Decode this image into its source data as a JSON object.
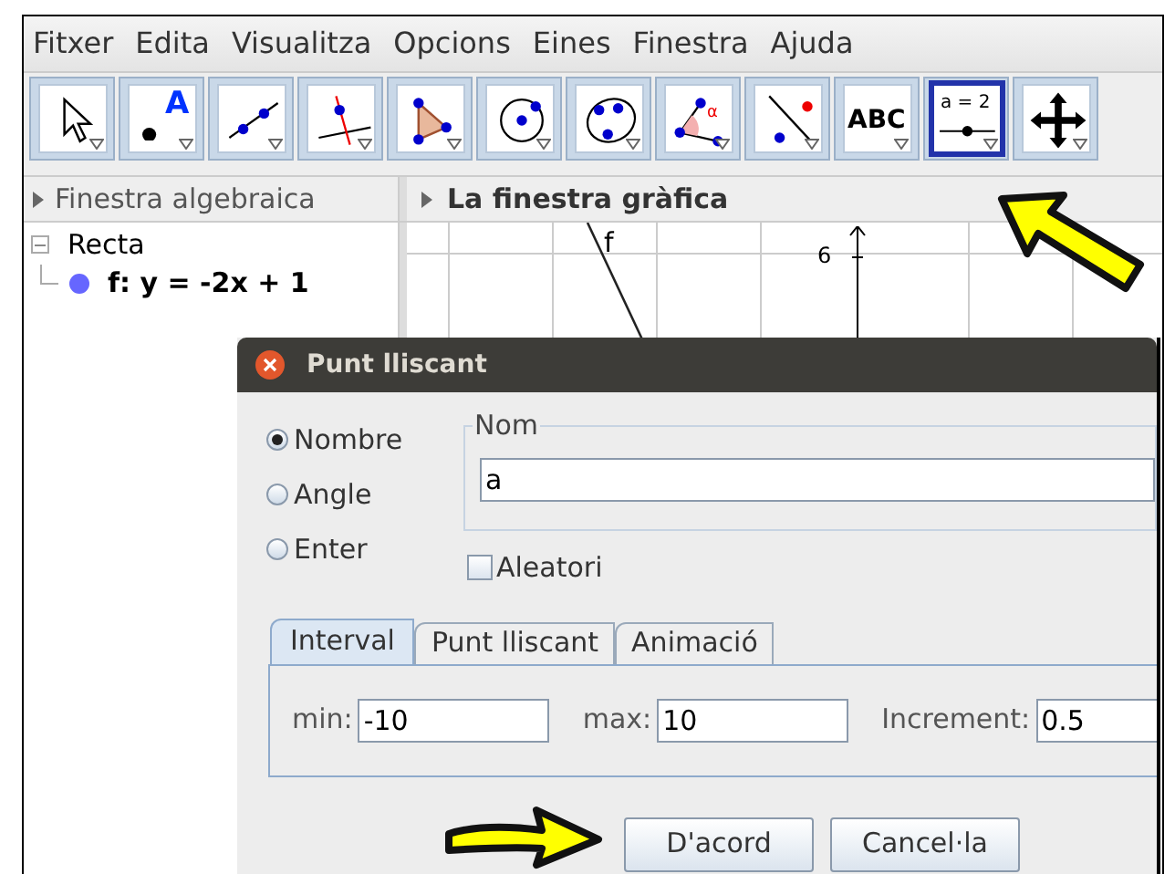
{
  "menu": [
    "Fitxer",
    "Edita",
    "Visualitza",
    "Opcions",
    "Eines",
    "Finestra",
    "Ajuda"
  ],
  "toolbar": [
    {
      "kind": "move",
      "selected": false
    },
    {
      "kind": "point",
      "label": "A",
      "selected": false
    },
    {
      "kind": "line",
      "selected": false
    },
    {
      "kind": "perpendicular",
      "selected": false
    },
    {
      "kind": "polygon",
      "selected": false
    },
    {
      "kind": "circle",
      "selected": false
    },
    {
      "kind": "conic",
      "selected": false
    },
    {
      "kind": "angle",
      "label": "α",
      "selected": false
    },
    {
      "kind": "reflect",
      "selected": false
    },
    {
      "kind": "text",
      "label": "ABC",
      "selected": false
    },
    {
      "kind": "slider",
      "label": "a = 2",
      "selected": true
    },
    {
      "kind": "pan",
      "selected": false
    }
  ],
  "algebra_panel": {
    "title": "Finestra algebraica",
    "tree": [
      {
        "label": "Recta",
        "expanded": true,
        "children": [
          {
            "label": "f: y = -2x + 1",
            "color": "#6666ff"
          }
        ]
      }
    ]
  },
  "graphics_panel": {
    "title": "La finestra gràfica",
    "line_label": "f",
    "axis_label": "6"
  },
  "dialog": {
    "title": "Punt lliscant",
    "types": [
      {
        "label": "Nombre",
        "selected": true
      },
      {
        "label": "Angle",
        "selected": false
      },
      {
        "label": "Enter",
        "selected": false
      }
    ],
    "name_group": "Nom",
    "name_value": "a",
    "random": {
      "label": "Aleatori",
      "checked": false
    },
    "tabs": [
      {
        "label": "Interval",
        "selected": true
      },
      {
        "label": "Punt lliscant",
        "selected": false
      },
      {
        "label": "Animació",
        "selected": false
      }
    ],
    "fields": [
      {
        "label": "min:",
        "value": "-10"
      },
      {
        "label": "max:",
        "value": "10"
      },
      {
        "label": "Increment:",
        "value": "0.5"
      }
    ],
    "buttons": [
      "D'acord",
      "Cancel·la"
    ]
  }
}
